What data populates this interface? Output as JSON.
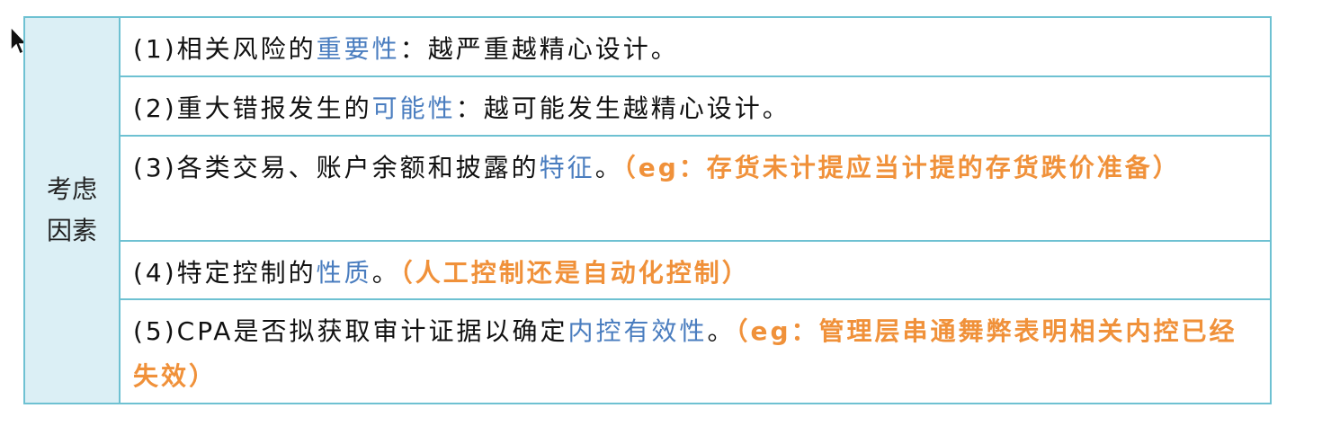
{
  "side_label": "考虑因素",
  "rows": [
    {
      "prefix": "(1)相关风险的",
      "highlight": "重要性",
      "rest": "：越严重越精心设计。",
      "note": ""
    },
    {
      "prefix": "(2)重大错报发生的",
      "highlight": "可能性",
      "rest": "：越可能发生越精心设计。",
      "note": ""
    },
    {
      "prefix": "(3)各类交易、账户余额和披露的",
      "highlight": "特征",
      "rest": "。",
      "note": "（eg：存货未计提应当计提的存货跌价准备）"
    },
    {
      "prefix": "(4)特定控制的",
      "highlight": "性质",
      "rest": "。",
      "note": "（人工控制还是自动化控制）"
    },
    {
      "prefix": "(5)CPA是否拟获取审计证据以确定",
      "highlight": "内控有效性",
      "rest": "。",
      "note": "（eg：管理层串通舞弊表明相关内控已经失效）"
    }
  ],
  "colors": {
    "border": "#6ec1d2",
    "side_bg": "#dbeff5",
    "highlight": "#4a7dbf",
    "note": "#f0913a"
  }
}
